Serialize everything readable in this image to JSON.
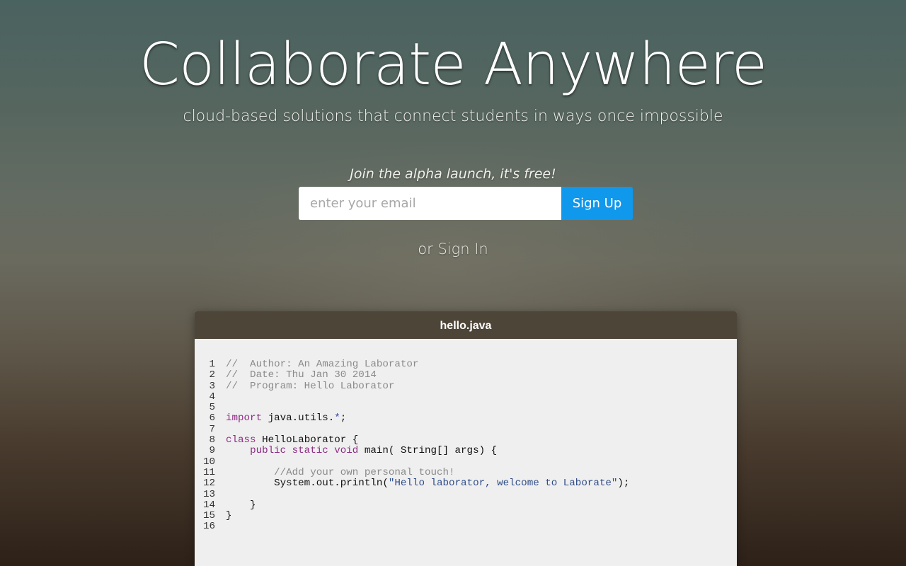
{
  "hero": {
    "headline": "Collaborate Anywhere",
    "subheadline": "cloud-based solutions that connect students in ways once impossible",
    "alpha_note": "Join the alpha launch, it's free!",
    "email_placeholder": "enter your email",
    "signup_label": "Sign Up",
    "signin_prefix": "or ",
    "signin_label": "Sign In"
  },
  "editor": {
    "filename": "hello.java",
    "lines": [
      {
        "n": "1",
        "tokens": [
          {
            "t": "comment",
            "v": "//  Author: An Amazing Laborator"
          }
        ]
      },
      {
        "n": "2",
        "tokens": [
          {
            "t": "comment",
            "v": "//  Date: Thu Jan 30 2014"
          }
        ]
      },
      {
        "n": "3",
        "tokens": [
          {
            "t": "comment",
            "v": "//  Program: Hello Laborator"
          }
        ]
      },
      {
        "n": "4",
        "tokens": []
      },
      {
        "n": "5",
        "tokens": []
      },
      {
        "n": "6",
        "tokens": [
          {
            "t": "keyword",
            "v": "import"
          },
          {
            "t": "plain",
            "v": " java.utils."
          },
          {
            "t": "operator",
            "v": "*"
          },
          {
            "t": "plain",
            "v": ";"
          }
        ]
      },
      {
        "n": "7",
        "tokens": []
      },
      {
        "n": "8",
        "tokens": [
          {
            "t": "keyword",
            "v": "class"
          },
          {
            "t": "plain",
            "v": " HelloLaborator {"
          }
        ]
      },
      {
        "n": "9",
        "tokens": [
          {
            "t": "plain",
            "v": "    "
          },
          {
            "t": "keyword",
            "v": "public static void"
          },
          {
            "t": "plain",
            "v": " main( String[] args) {"
          }
        ]
      },
      {
        "n": "10",
        "tokens": []
      },
      {
        "n": "11",
        "tokens": [
          {
            "t": "plain",
            "v": "        "
          },
          {
            "t": "comment",
            "v": "//Add your own personal touch!"
          }
        ]
      },
      {
        "n": "12",
        "tokens": [
          {
            "t": "plain",
            "v": "        System.out.println("
          },
          {
            "t": "string",
            "v": "\"Hello laborator, welcome to Laborate\""
          },
          {
            "t": "plain",
            "v": ");"
          }
        ]
      },
      {
        "n": "13",
        "tokens": []
      },
      {
        "n": "14",
        "tokens": [
          {
            "t": "plain",
            "v": "    }"
          }
        ]
      },
      {
        "n": "15",
        "tokens": [
          {
            "t": "plain",
            "v": "}"
          }
        ]
      },
      {
        "n": "16",
        "tokens": []
      }
    ]
  },
  "colors": {
    "signup_button": "#0f98ec",
    "editor_titlebar": "#4e4539",
    "editor_background": "#efefef",
    "keyword": "#8e2c86",
    "comment": "#8a8a8a",
    "string": "#2e4c87"
  }
}
